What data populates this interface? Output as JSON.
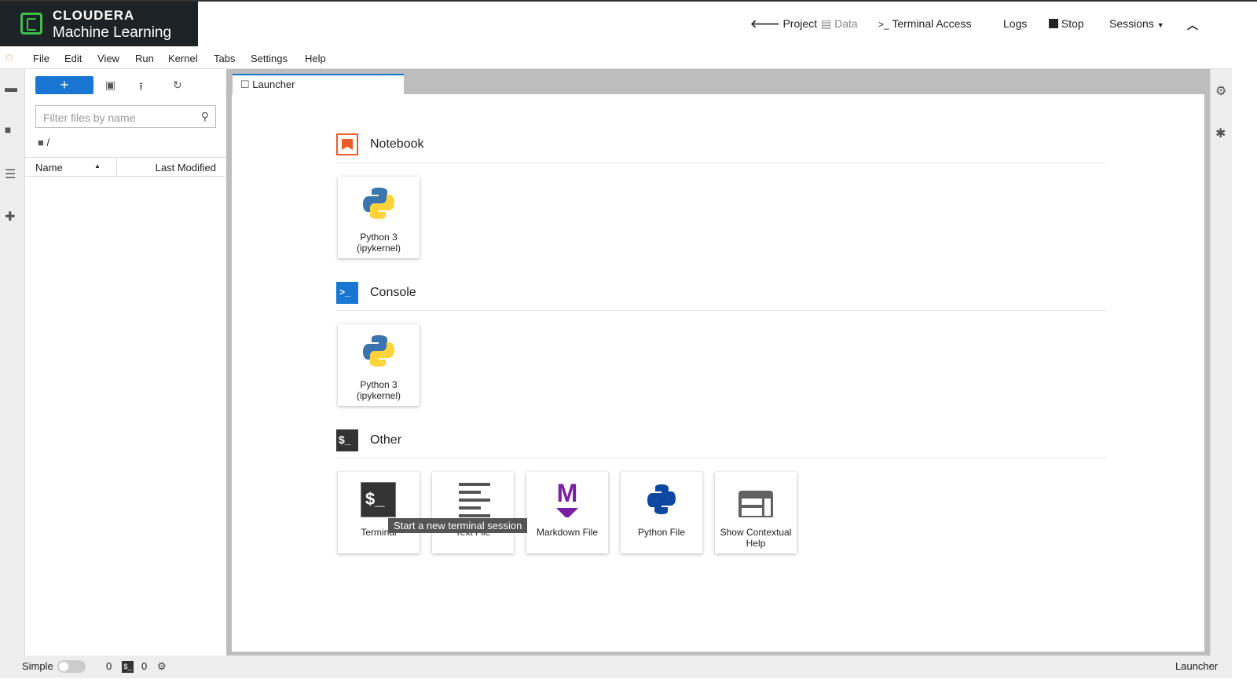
{
  "header": {
    "brand": "CLOUDERA",
    "product": "Machine Learning",
    "nav": {
      "project": "Project",
      "data": "Data",
      "terminal": "Terminal Access",
      "logs": "Logs",
      "stop": "Stop",
      "sessions": "Sessions"
    }
  },
  "menu": [
    "File",
    "Edit",
    "View",
    "Run",
    "Kernel",
    "Tabs",
    "Settings",
    "Help"
  ],
  "filebrowser": {
    "new_label": "+",
    "filter_placeholder": "Filter files by name",
    "path": "/",
    "col_name": "Name",
    "col_modified": "Last Modified"
  },
  "tab": {
    "label": "Launcher"
  },
  "launcher": {
    "sections": [
      {
        "title": "Notebook",
        "cards": [
          {
            "label": "Python 3 (ipykernel)"
          }
        ]
      },
      {
        "title": "Console",
        "cards": [
          {
            "label": "Python 3 (ipykernel)"
          }
        ]
      },
      {
        "title": "Other",
        "cards": [
          {
            "label": "Terminal"
          },
          {
            "label": "Text File"
          },
          {
            "label": "Markdown File"
          },
          {
            "label": "Python File"
          },
          {
            "label": "Show Contextual Help"
          }
        ]
      }
    ],
    "tooltip": "Start a new terminal session"
  },
  "status": {
    "mode": "Simple",
    "kernels": "0",
    "terminals": "0",
    "right": "Launcher"
  },
  "colors": {
    "accent": "#1976d2",
    "notebook": "#f05a28",
    "console": "#1976d2",
    "markdown": "#7b1fa2"
  }
}
